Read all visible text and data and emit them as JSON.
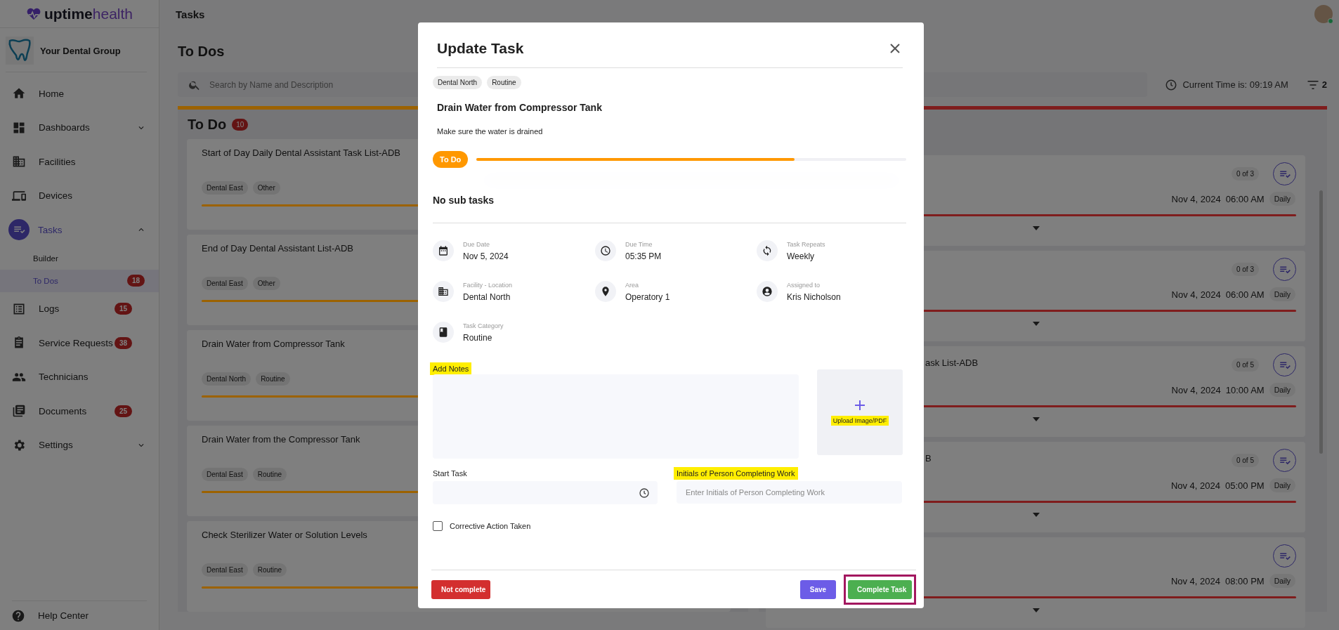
{
  "sidebar": {
    "logo": {
      "part_1": "uptime",
      "part_2": "health"
    },
    "org": "Your Dental Group",
    "items": [
      {
        "label": "Home",
        "selected": false
      },
      {
        "label": "Dashboards",
        "selected": false,
        "expanded": false
      },
      {
        "label": "Facilities",
        "selected": false
      },
      {
        "label": "Devices",
        "selected": false
      },
      {
        "label": "Tasks",
        "selected": true,
        "expanded": true,
        "children": [
          {
            "label": "Builder",
            "selected": false
          },
          {
            "label": "To Dos",
            "selected": true,
            "badge": "18"
          }
        ]
      },
      {
        "label": "Logs",
        "selected": false,
        "badge": "15"
      },
      {
        "label": "Service Requests",
        "selected": false,
        "badge": "38"
      },
      {
        "label": "Technicians",
        "selected": false
      },
      {
        "label": "Documents",
        "selected": false,
        "badge": "25"
      },
      {
        "label": "Settings",
        "selected": false,
        "expanded": false
      }
    ],
    "footer": {
      "label": "Help Center"
    }
  },
  "header": {
    "title": "Tasks",
    "avatar": {
      "online": true
    }
  },
  "page": {
    "heading": "To Dos",
    "search": {
      "placeholder": "Search by Name and Description"
    },
    "current_time": "Current Time is: 09:19 AM",
    "filter_count": "2"
  },
  "columns": [
    {
      "title": "To Do",
      "count": "10",
      "color": "#9c6200",
      "cards": [
        {
          "title": "Start of Day Daily Dental Assistant Task List-ADB",
          "tags": [
            "Dental East",
            "Other"
          ],
          "level": 0.74
        },
        {
          "title": "End of Day Dental Assistant List-ADB",
          "tags": [
            "Dental East",
            "Other"
          ],
          "level": 0.74
        },
        {
          "title": "Drain Water from Compressor Tank",
          "tags": [
            "Dental North",
            "Routine"
          ],
          "level": 0.74
        },
        {
          "title": "Drain Water from the Compressor Tank",
          "tags": [
            "Dental East",
            "Routine"
          ],
          "level": 0.74
        },
        {
          "title": "Check Sterilizer Water or Solution Levels",
          "tags": [
            "Dental East",
            "Routine"
          ],
          "level": 0.74
        }
      ]
    },
    {
      "color": "#7f1d1d",
      "cards": [
        {
          "count": "0 of 3",
          "date": "Nov 4, 2024",
          "time": "06:00 AM",
          "repeat": "Daily",
          "level": 1
        },
        {
          "count": "0 of 3",
          "date": "Nov 4, 2024",
          "time": "06:00 AM",
          "repeat": "Daily",
          "level": 1
        },
        {
          "title": "ask List-ADB",
          "count": "0 of 5",
          "date": "Nov 4, 2024",
          "time": "10:00 AM",
          "repeat": "Daily",
          "level": 1
        },
        {
          "title": "B",
          "count": "0 of 5",
          "date": "Nov 4, 2024",
          "time": "05:00 PM",
          "repeat": "Daily",
          "level": 1
        },
        {
          "date": "Nov 4, 2024",
          "time": "08:00 PM",
          "repeat": "Daily",
          "level": 1
        }
      ]
    }
  ],
  "modal": {
    "title": "Update Task",
    "tags": [
      "Dental North",
      "Routine"
    ],
    "task_title": "Drain Water from Compressor Tank",
    "description": "Make sure the water is drained",
    "status": {
      "label": "To Do",
      "level": 0.74
    },
    "subtasks": "No sub tasks",
    "details": [
      {
        "label": "Due Date",
        "value": "Nov 5, 2024"
      },
      {
        "label": "Due Time",
        "value": "05:35 PM"
      },
      {
        "label": "Task Repeats",
        "value": "Weekly"
      },
      {
        "label": "Facility - Location",
        "value": "Dental North"
      },
      {
        "label": "Area",
        "value": "Operatory 1"
      },
      {
        "label": "Assigned to",
        "value": "Kris Nicholson"
      },
      {
        "label": "Task Category",
        "value": "Routine"
      }
    ],
    "notes": {
      "label": "Add Notes",
      "highlighted": true
    },
    "upload": {
      "label": "Upload Image/PDF",
      "highlighted": true
    },
    "start_task": {
      "label": "Start Task",
      "highlighted": false
    },
    "initials": {
      "label": "Initials of Person Completing Work",
      "highlighted": true,
      "placeholder": "Enter Initials of Person Completing Work"
    },
    "corrective": {
      "label": "Corrective Action Taken",
      "checked": false
    },
    "buttons": [
      {
        "label": "Not complete",
        "kind": "danger",
        "outlined": false
      },
      {
        "label": "Save",
        "kind": "primary",
        "outlined": false
      },
      {
        "label": "Complete Task",
        "kind": "success",
        "outlined": true
      }
    ]
  }
}
